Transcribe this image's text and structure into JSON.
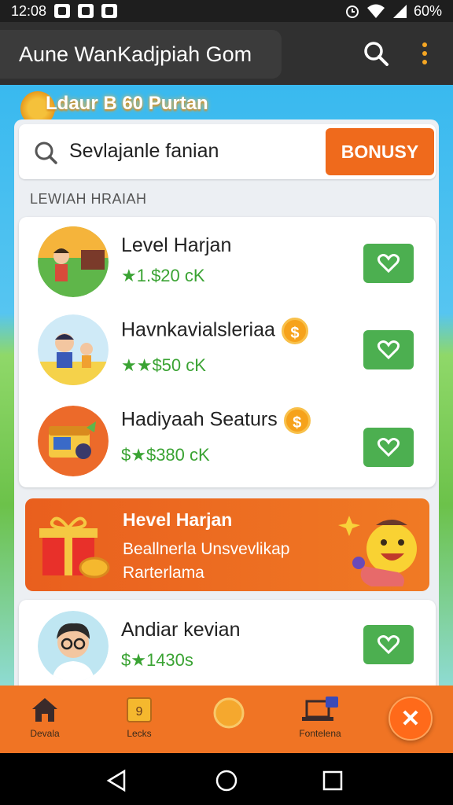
{
  "status_bar": {
    "time": "12:08",
    "battery": "60%",
    "icons": [
      "app-notification-icon",
      "message-icon",
      "instagram-icon",
      "alarm-icon",
      "wifi-icon",
      "signal-icon"
    ]
  },
  "app_bar": {
    "title": "Aune WanKadjpiah Gom",
    "search_icon": "search-icon",
    "menu_icon": "more-vert-icon",
    "accent": "#f5a623"
  },
  "banner": {
    "text": "Ldaur B 60 Purtan"
  },
  "search": {
    "value": "Sevlajanle fanian",
    "button_label": "BONUSY"
  },
  "section": {
    "title": "LEWIAH HRAIAH"
  },
  "rows": [
    {
      "title": "Level Harjan",
      "reward": "★1.$20 cK",
      "has_coin": false,
      "checked": true
    },
    {
      "title": "Havnkavialsleriaa",
      "reward": "★★$50 cK",
      "has_coin": true,
      "coin_symbol": "$",
      "checked": true
    },
    {
      "title": "Hadiyaah Seaturs",
      "reward": "$★$380 cK",
      "has_coin": true,
      "coin_symbol": "$",
      "checked": true
    }
  ],
  "promo": {
    "title": "Hevel Harjan",
    "subtitle": "Beallnerla Unsvevlikap Rarterlama",
    "color": "#ef6a1c"
  },
  "row_extra": {
    "title": "Andiar kevian",
    "reward": "$★1430s",
    "checked": true
  },
  "bottom_nav": {
    "items": [
      {
        "label": "Devala",
        "icon": "home-icon"
      },
      {
        "label": "Lecks",
        "icon": "wallet-icon"
      },
      {
        "label": "",
        "icon": "compass-icon"
      },
      {
        "label": "Fontelena",
        "icon": "laptop-icon"
      }
    ],
    "fab_icon": "close-icon",
    "fab_symbol": "✕",
    "color": "#f07424"
  },
  "system_nav": {
    "icons": [
      "back-icon",
      "home-circle-icon",
      "recents-icon"
    ]
  },
  "colors": {
    "accent_orange": "#ef6a1c",
    "check_green": "#4caf50",
    "reward_green": "#3aa333"
  }
}
